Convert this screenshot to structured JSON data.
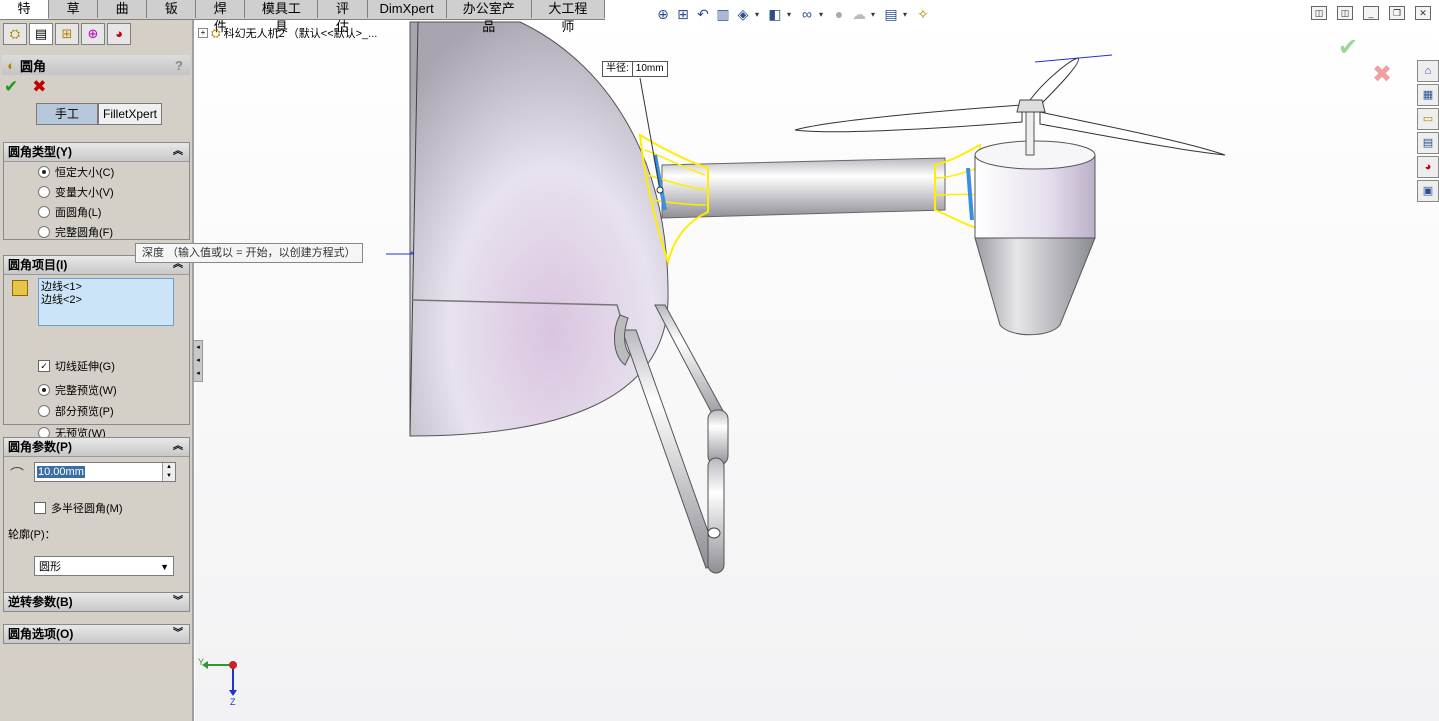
{
  "tabs": [
    "特征",
    "草图",
    "曲面",
    "钣金",
    "焊件",
    "模具工具",
    "评估",
    "DimXpert",
    "办公室产品",
    "大工程师"
  ],
  "active_tab": "特征",
  "view_toolbar_icons": [
    "zoom-fit-icon",
    "zoom-area-icon",
    "previous-view-icon",
    "section-view-icon",
    "view-orientation-icon",
    "display-style-icon",
    "hide-show-icon",
    "edit-appearance-icon",
    "apply-scene-icon",
    "view-settings-icon"
  ],
  "panel": {
    "icon_tabs": [
      "feature-manager-icon",
      "property-manager-icon",
      "configuration-manager-icon",
      "dimxpert-manager-icon",
      "display-manager-icon"
    ],
    "title": "圆角",
    "help": "?",
    "ok_symbol": "✔",
    "cancel_symbol": "✖",
    "mode_manual": "手工",
    "mode_fxpert": "FilletXpert",
    "fillet_type": {
      "header": "圆角类型(Y)",
      "options": [
        "恒定大小(C)",
        "变量大小(V)",
        "面圆角(L)",
        "完整圆角(F)"
      ],
      "selected": 0
    },
    "fillet_items": {
      "header": "圆角项目(I)",
      "edges": [
        "边线<1>",
        "边线<2>"
      ],
      "tangent": "切线延伸(G)",
      "preview_options": [
        "完整预览(W)",
        "部分预览(P)",
        "无预览(W)"
      ],
      "preview_selected": 0
    },
    "fillet_params": {
      "header": "圆角参数(P)",
      "radius": "10.00mm",
      "multi_radius": "多半径圆角(M)",
      "profile_label": "轮廓(P)：",
      "profile_value": "圆形"
    },
    "setback": {
      "header": "逆转参数(B)"
    },
    "options": {
      "header": "圆角选项(O)"
    }
  },
  "tooltip": "深度 （输入值或以 = 开始，以创建方程式）",
  "tree": {
    "label": "科幻无人机2 （默认<<默认>_..."
  },
  "dim": {
    "label": "半径:",
    "value": "10mm"
  },
  "triad": {
    "y": "Y",
    "z": "Z"
  },
  "colors": {
    "fillet_highlight": "#ffee00",
    "selected_edge": "#3a8fe0",
    "panel_bg": "#d4d0c8"
  }
}
